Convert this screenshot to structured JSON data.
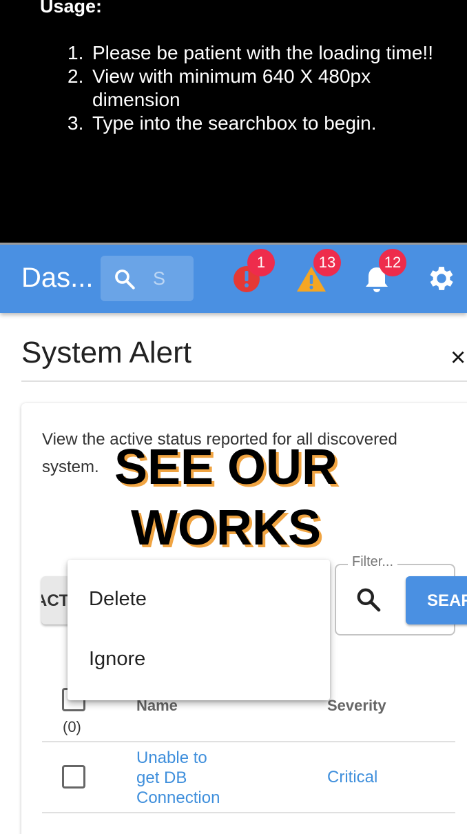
{
  "usage": {
    "title": "Usage:",
    "items": [
      {
        "num": "1.",
        "text": "Please be patient with the loading time!!"
      },
      {
        "num": "2.",
        "text": "View with minimum 640 X 480px dimension"
      },
      {
        "num": "3.",
        "text": "Type into the searchbox to begin."
      }
    ]
  },
  "appbar": {
    "title": "Das...",
    "search_placeholder": "S",
    "badges": {
      "errors": "1",
      "warnings": "13",
      "notifications": "12"
    },
    "colors": {
      "bar": "#4a90e2",
      "badge": "#ee2c4c",
      "error_icon": "#e53935",
      "warning_icon": "#f5a623"
    }
  },
  "dialog": {
    "title": "System Alert",
    "close": "×",
    "description": "View the active status reported for all discovered system.",
    "overlay": {
      "line1": "SEE OUR",
      "line2": "WORKS"
    },
    "actions_label": "ACTIONS",
    "filter_label": "Filter...",
    "search_label": "SEARCH",
    "menu": [
      "Delete",
      "Ignore"
    ],
    "table": {
      "selected_count": "(0)",
      "headers": {
        "name": "Name",
        "severity": "Severity"
      },
      "rows": [
        {
          "name_lines": [
            "Unable to",
            "get DB",
            "Connection"
          ],
          "severity": "Critical"
        }
      ]
    }
  }
}
